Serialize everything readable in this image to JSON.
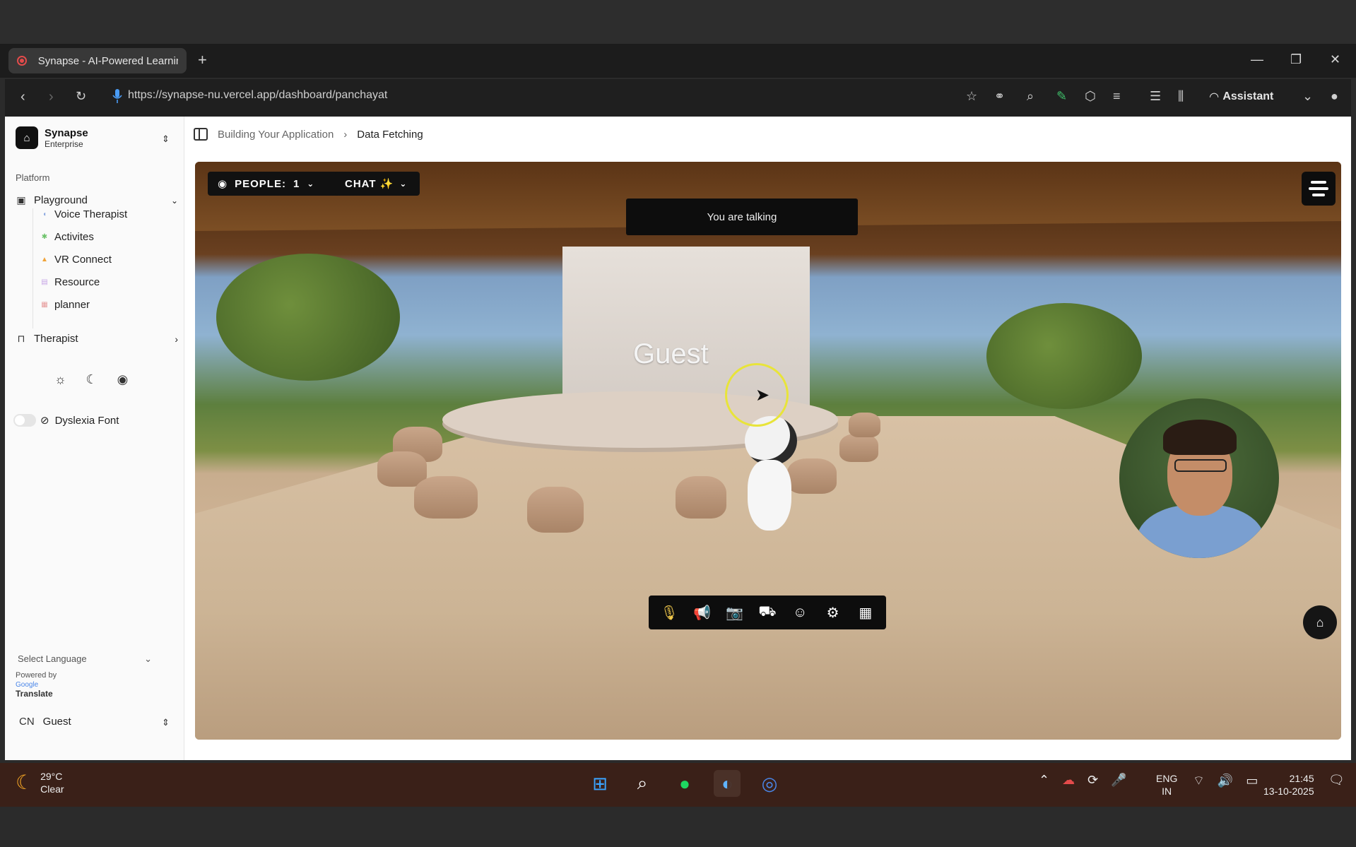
{
  "browser": {
    "tab_title": "Synapse - AI-Powered Learnin",
    "new_tab": "+",
    "url": "https://synapse-nu.vercel.app/dashboard/panchayat",
    "assistant_label": "Assistant"
  },
  "sidebar": {
    "brand_name": "Synapse",
    "brand_sub": "Enterprise",
    "section_label": "Platform",
    "playground_label": "Playground",
    "sub_items": [
      {
        "label": "Voice Therapist",
        "icon": "voice-icon",
        "color": "#8aa8e0"
      },
      {
        "label": "Activites",
        "icon": "puzzle-icon",
        "color": "#6cc26a"
      },
      {
        "label": "VR Connect",
        "icon": "flask-icon",
        "color": "#f0a33a"
      },
      {
        "label": "Resource",
        "icon": "book-icon",
        "color": "#c7a5e6"
      },
      {
        "label": "planner",
        "icon": "calendar-icon",
        "color": "#e69a9a"
      }
    ],
    "therapist_label": "Therapist",
    "dyslexia_label": "Dyslexia Font",
    "select_language": "Select Language",
    "powered_by": "Powered by",
    "google": "Google",
    "translate": "Translate",
    "user_initials": "CN",
    "user_name": "Guest"
  },
  "main": {
    "breadcrumb_parent": "Building Your Application",
    "breadcrumb_current": "Data Fetching",
    "people_label": "PEOPLE:",
    "people_count": "1",
    "chat_label": "CHAT ✨",
    "talking_banner": "You are talking",
    "guest_name": "Guest"
  },
  "taskbar": {
    "temperature": "29°C",
    "weather": "Clear",
    "lang_line1": "ENG",
    "lang_line2": "IN",
    "time": "21:45",
    "date": "13-10-2025"
  },
  "colors": {
    "accent_yellow": "#e8e43a",
    "recording_red": "#e34b4b",
    "mic_blue": "#4a9cf5"
  }
}
